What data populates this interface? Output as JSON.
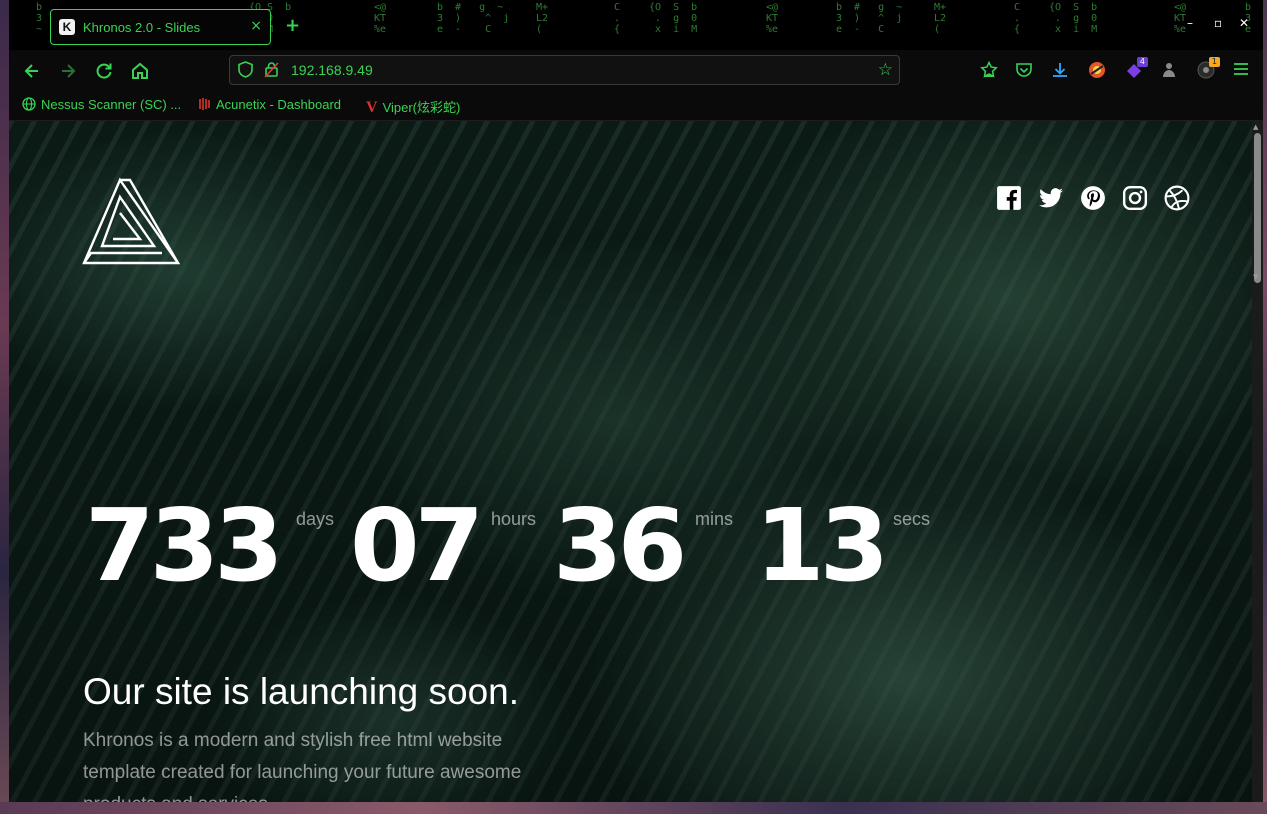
{
  "browser": {
    "tab": {
      "favicon": "K",
      "title": "Khronos 2.0 - Slides",
      "close": "×"
    },
    "new_tab": "+",
    "window_controls": [
      "–",
      "▫",
      "✕"
    ],
    "address": {
      "url": "192.168.9.49"
    },
    "extensions": [
      {
        "name": "bookmark-star-icon",
        "badge": ""
      },
      {
        "name": "pocket-icon",
        "badge": ""
      },
      {
        "name": "download-icon",
        "badge": ""
      },
      {
        "name": "extension-orange-icon",
        "badge": ""
      },
      {
        "name": "extension-purple-icon",
        "badge": "4"
      },
      {
        "name": "extension-gray-icon",
        "badge": ""
      },
      {
        "name": "extension-dark-icon",
        "badge": "1"
      },
      {
        "name": "menu-icon",
        "badge": ""
      }
    ],
    "bookmarks": [
      {
        "label": "Nessus Scanner (SC) ...",
        "icon": "globe-icon"
      },
      {
        "label": "Acunetix - Dashboard",
        "icon": "acunetix-icon"
      },
      {
        "label": "Viper(炫彩蛇)",
        "icon": "viper-icon"
      }
    ]
  },
  "page": {
    "countdown": {
      "days": "733",
      "days_label": "days",
      "hours": "07",
      "hours_label": "hours",
      "mins": "36",
      "mins_label": "mins",
      "secs": "13",
      "secs_label": "secs"
    },
    "headline": "Our site is launching soon.",
    "description": "Khronos is a modern and stylish free html website template created for launching your future awesome products and services.",
    "social": [
      "facebook-icon",
      "twitter-icon",
      "pinterest-icon",
      "instagram-icon",
      "dribbble-icon"
    ]
  },
  "colors": {
    "accent": "#39d353",
    "background": "#000000"
  }
}
